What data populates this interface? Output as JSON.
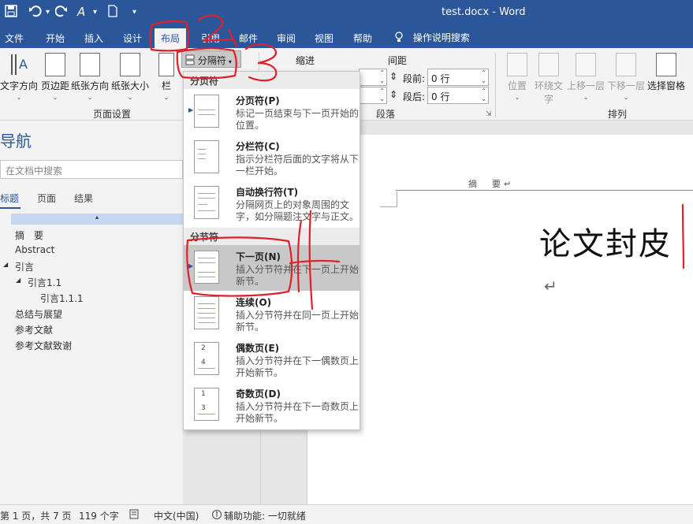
{
  "window": {
    "title": "test.docx  -  Word",
    "qat": {
      "save_icon": "save-icon",
      "undo_icon": "undo-icon",
      "format_icon": "A",
      "customize": "▾"
    }
  },
  "tabs": [
    {
      "label": "文件"
    },
    {
      "label": "开始"
    },
    {
      "label": "插入"
    },
    {
      "label": "设计"
    },
    {
      "label": "布局"
    },
    {
      "label": "引用"
    },
    {
      "label": "邮件"
    },
    {
      "label": "审阅"
    },
    {
      "label": "视图"
    },
    {
      "label": "帮助"
    }
  ],
  "tell_me": "操作说明搜索",
  "ribbon": {
    "page_setup": {
      "text_direction": "文字方向",
      "margins": "页边距",
      "orientation": "纸张方向",
      "size": "纸张大小",
      "columns": "栏",
      "breaks": "分隔符",
      "group_label": "页面设置"
    },
    "paragraph": {
      "indent_label": "缩进",
      "spacing_label": "间距",
      "before_label": "段前:",
      "before_value": "0 行",
      "after_label": "段后:",
      "after_value": "0 行",
      "group_label": "段落"
    },
    "arrange": {
      "position": "位置",
      "wrap_text": "环绕文字",
      "bring_forward": "上移一层",
      "send_backward": "下移一层",
      "selection_pane": "选择窗格",
      "group_label": "排列"
    }
  },
  "nav": {
    "title": "导航",
    "search_placeholder": "在文档中搜索",
    "tabs": [
      "标题",
      "页面",
      "结果"
    ],
    "top_bar": "▴",
    "items": [
      {
        "label": "摘　要",
        "level": 1,
        "toggle": ""
      },
      {
        "label": "Abstract",
        "level": 1,
        "toggle": ""
      },
      {
        "label": "引言",
        "level": 1,
        "toggle": "◢"
      },
      {
        "label": "引言1.1",
        "level": 2,
        "toggle": "◢"
      },
      {
        "label": "引言1.1.1",
        "level": 3,
        "toggle": ""
      },
      {
        "label": "总结与展望",
        "level": 1,
        "toggle": ""
      },
      {
        "label": "参考文献",
        "level": 1,
        "toggle": ""
      },
      {
        "label": "参考文献致谢",
        "level": 1,
        "toggle": ""
      }
    ]
  },
  "menu": {
    "section_page": "分页符",
    "section_section": "分节符",
    "items": [
      {
        "title": "分页符(P)",
        "desc": "标记一页结束与下一页开始的位置。"
      },
      {
        "title": "分栏符(C)",
        "desc": "指示分栏符后面的文字将从下一栏开始。"
      },
      {
        "title": "自动换行符(T)",
        "desc": "分隔网页上的对象周围的文字，如分隔题注文字与正文。"
      },
      {
        "title": "下一页(N)",
        "desc": "插入分节符并在下一页上开始新节。"
      },
      {
        "title": "连续(O)",
        "desc": "插入分节符并在同一页上开始新节。"
      },
      {
        "title": "偶数页(E)",
        "desc": "插入分节符并在下一偶数页上开始新节。"
      },
      {
        "title": "奇数页(D)",
        "desc": "插入分节符并在下一奇数页上开始新节。"
      }
    ]
  },
  "document": {
    "header_text": "摘　要↵",
    "cover_title": "论文封皮",
    "return_mark": "↵"
  },
  "status": {
    "page": "第 1 页，共 7 页",
    "words": "119 个字",
    "language": "中文(中国)",
    "accessibility": "辅助功能: 一切就绪"
  },
  "colors": {
    "brand": "#2b579a",
    "annotation": "#e0202a",
    "menu_hover": "#c8c8c8",
    "section_header": "#ececec"
  }
}
